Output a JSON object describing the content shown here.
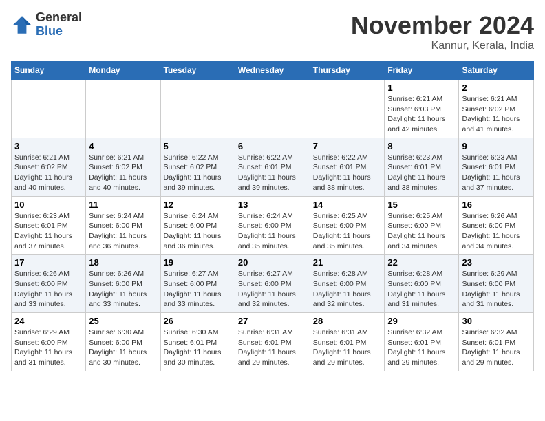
{
  "header": {
    "logo_general": "General",
    "logo_blue": "Blue",
    "month_title": "November 2024",
    "location": "Kannur, Kerala, India"
  },
  "days_of_week": [
    "Sunday",
    "Monday",
    "Tuesday",
    "Wednesday",
    "Thursday",
    "Friday",
    "Saturday"
  ],
  "weeks": [
    [
      {
        "day": "",
        "info": ""
      },
      {
        "day": "",
        "info": ""
      },
      {
        "day": "",
        "info": ""
      },
      {
        "day": "",
        "info": ""
      },
      {
        "day": "",
        "info": ""
      },
      {
        "day": "1",
        "info": "Sunrise: 6:21 AM\nSunset: 6:03 PM\nDaylight: 11 hours and 42 minutes."
      },
      {
        "day": "2",
        "info": "Sunrise: 6:21 AM\nSunset: 6:02 PM\nDaylight: 11 hours and 41 minutes."
      }
    ],
    [
      {
        "day": "3",
        "info": "Sunrise: 6:21 AM\nSunset: 6:02 PM\nDaylight: 11 hours and 40 minutes."
      },
      {
        "day": "4",
        "info": "Sunrise: 6:21 AM\nSunset: 6:02 PM\nDaylight: 11 hours and 40 minutes."
      },
      {
        "day": "5",
        "info": "Sunrise: 6:22 AM\nSunset: 6:02 PM\nDaylight: 11 hours and 39 minutes."
      },
      {
        "day": "6",
        "info": "Sunrise: 6:22 AM\nSunset: 6:01 PM\nDaylight: 11 hours and 39 minutes."
      },
      {
        "day": "7",
        "info": "Sunrise: 6:22 AM\nSunset: 6:01 PM\nDaylight: 11 hours and 38 minutes."
      },
      {
        "day": "8",
        "info": "Sunrise: 6:23 AM\nSunset: 6:01 PM\nDaylight: 11 hours and 38 minutes."
      },
      {
        "day": "9",
        "info": "Sunrise: 6:23 AM\nSunset: 6:01 PM\nDaylight: 11 hours and 37 minutes."
      }
    ],
    [
      {
        "day": "10",
        "info": "Sunrise: 6:23 AM\nSunset: 6:01 PM\nDaylight: 11 hours and 37 minutes."
      },
      {
        "day": "11",
        "info": "Sunrise: 6:24 AM\nSunset: 6:00 PM\nDaylight: 11 hours and 36 minutes."
      },
      {
        "day": "12",
        "info": "Sunrise: 6:24 AM\nSunset: 6:00 PM\nDaylight: 11 hours and 36 minutes."
      },
      {
        "day": "13",
        "info": "Sunrise: 6:24 AM\nSunset: 6:00 PM\nDaylight: 11 hours and 35 minutes."
      },
      {
        "day": "14",
        "info": "Sunrise: 6:25 AM\nSunset: 6:00 PM\nDaylight: 11 hours and 35 minutes."
      },
      {
        "day": "15",
        "info": "Sunrise: 6:25 AM\nSunset: 6:00 PM\nDaylight: 11 hours and 34 minutes."
      },
      {
        "day": "16",
        "info": "Sunrise: 6:26 AM\nSunset: 6:00 PM\nDaylight: 11 hours and 34 minutes."
      }
    ],
    [
      {
        "day": "17",
        "info": "Sunrise: 6:26 AM\nSunset: 6:00 PM\nDaylight: 11 hours and 33 minutes."
      },
      {
        "day": "18",
        "info": "Sunrise: 6:26 AM\nSunset: 6:00 PM\nDaylight: 11 hours and 33 minutes."
      },
      {
        "day": "19",
        "info": "Sunrise: 6:27 AM\nSunset: 6:00 PM\nDaylight: 11 hours and 33 minutes."
      },
      {
        "day": "20",
        "info": "Sunrise: 6:27 AM\nSunset: 6:00 PM\nDaylight: 11 hours and 32 minutes."
      },
      {
        "day": "21",
        "info": "Sunrise: 6:28 AM\nSunset: 6:00 PM\nDaylight: 11 hours and 32 minutes."
      },
      {
        "day": "22",
        "info": "Sunrise: 6:28 AM\nSunset: 6:00 PM\nDaylight: 11 hours and 31 minutes."
      },
      {
        "day": "23",
        "info": "Sunrise: 6:29 AM\nSunset: 6:00 PM\nDaylight: 11 hours and 31 minutes."
      }
    ],
    [
      {
        "day": "24",
        "info": "Sunrise: 6:29 AM\nSunset: 6:00 PM\nDaylight: 11 hours and 31 minutes."
      },
      {
        "day": "25",
        "info": "Sunrise: 6:30 AM\nSunset: 6:00 PM\nDaylight: 11 hours and 30 minutes."
      },
      {
        "day": "26",
        "info": "Sunrise: 6:30 AM\nSunset: 6:01 PM\nDaylight: 11 hours and 30 minutes."
      },
      {
        "day": "27",
        "info": "Sunrise: 6:31 AM\nSunset: 6:01 PM\nDaylight: 11 hours and 29 minutes."
      },
      {
        "day": "28",
        "info": "Sunrise: 6:31 AM\nSunset: 6:01 PM\nDaylight: 11 hours and 29 minutes."
      },
      {
        "day": "29",
        "info": "Sunrise: 6:32 AM\nSunset: 6:01 PM\nDaylight: 11 hours and 29 minutes."
      },
      {
        "day": "30",
        "info": "Sunrise: 6:32 AM\nSunset: 6:01 PM\nDaylight: 11 hours and 29 minutes."
      }
    ]
  ]
}
